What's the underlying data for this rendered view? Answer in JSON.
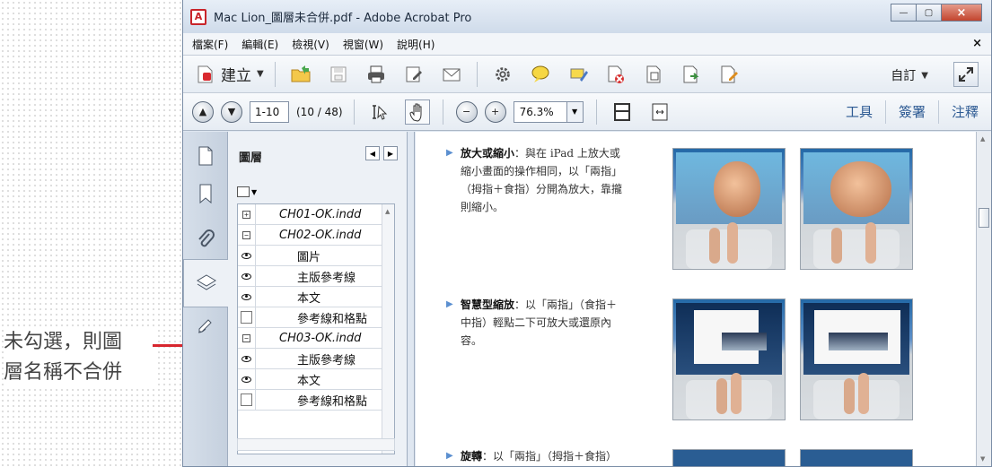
{
  "annotation": {
    "line1": "未勾選，則圖",
    "line2": "層名稱不合併",
    "color": "#d7262e"
  },
  "window": {
    "title": "Mac Lion_圖層未合併.pdf - Adobe Acrobat Pro",
    "controls": [
      "minimize",
      "restore",
      "close"
    ]
  },
  "menu": {
    "items": [
      "檔案(F)",
      "編輯(E)",
      "檢視(V)",
      "視窗(W)",
      "說明(H)"
    ],
    "close": "×"
  },
  "toolbar": {
    "create_label": "建立",
    "customize_label": "自訂",
    "icons": [
      "create-icon",
      "open-icon",
      "save-icon",
      "print-icon",
      "edit-icon",
      "email-icon",
      "settings-icon",
      "comment-icon",
      "highlight-icon",
      "delete-page-icon",
      "page-icon",
      "extract-icon",
      "sign-icon",
      "expand-icon"
    ]
  },
  "navigation": {
    "page_input": "1-10",
    "page_count": "(10 / 48)",
    "zoom": "76.3%",
    "tabs": [
      "工具",
      "簽署",
      "注釋"
    ]
  },
  "layers_panel": {
    "title": "圖層",
    "nav_left": "◀",
    "nav_right": "▶",
    "groups": [
      {
        "name": "CH01-OK.indd",
        "state": "collapsed",
        "layers": []
      },
      {
        "name": "CH02-OK.indd",
        "state": "expanded",
        "layers": [
          {
            "name": "圖片",
            "visible": true
          },
          {
            "name": "主版參考線",
            "visible": true
          },
          {
            "name": "本文",
            "visible": true
          },
          {
            "name": "參考線和格點",
            "visible": false
          }
        ]
      },
      {
        "name": "CH03-OK.indd",
        "state": "expanded",
        "layers": [
          {
            "name": "主版參考線",
            "visible": true
          },
          {
            "name": "本文",
            "visible": true
          },
          {
            "name": "參考線和格點",
            "visible": false
          }
        ]
      }
    ]
  },
  "document": {
    "sections": [
      {
        "heading": "放大或縮小",
        "text_lines": [
          "：與在 iPad 上放大或",
          "縮小畫面的操作相同，以「兩指」",
          "（拇指＋食指）分開為放大，靠攏",
          "則縮小。"
        ]
      },
      {
        "heading": "智慧型縮放",
        "text_lines": [
          "：以「兩指」（食指＋",
          "中指）輕點二下可放大或還原內",
          "容。"
        ]
      },
      {
        "heading": "旋轉",
        "text_lines": [
          "：以「兩指」（拇指＋食指）"
        ]
      }
    ]
  }
}
